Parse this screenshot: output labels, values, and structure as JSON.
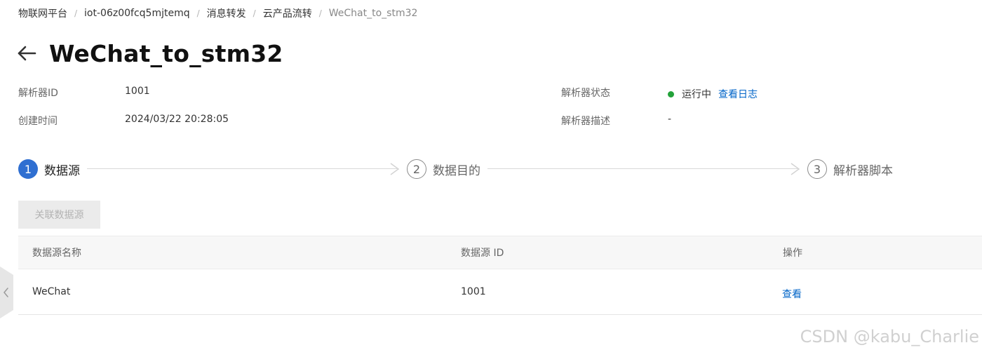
{
  "breadcrumb": {
    "items": [
      "物联网平台",
      "iot-06z00fcq5mjtemq",
      "消息转发",
      "云产品流转",
      "WeChat_to_stm32"
    ],
    "separator": "/"
  },
  "header": {
    "title": "WeChat_to_stm32",
    "back_icon": "arrow-left-icon"
  },
  "info": {
    "parser_id_label": "解析器ID",
    "parser_id_value": "1001",
    "created_label": "创建时间",
    "created_value": "2024/03/22 20:28:05",
    "status_label": "解析器状态",
    "status_value": "运行中",
    "status_color": "#23a23a",
    "view_log_link": "查看日志",
    "desc_label": "解析器描述",
    "desc_value": "-"
  },
  "steps": [
    {
      "number": "1",
      "label": "数据源",
      "state": "active"
    },
    {
      "number": "2",
      "label": "数据目的",
      "state": "idle"
    },
    {
      "number": "3",
      "label": "解析器脚本",
      "state": "idle"
    }
  ],
  "actions": {
    "associate_source_label": "关联数据源",
    "associate_source_disabled": true
  },
  "table": {
    "columns": [
      "数据源名称",
      "数据源 ID",
      "操作"
    ],
    "rows": [
      {
        "name": "WeChat",
        "id": "1001",
        "action": "查看"
      }
    ]
  },
  "side_tab": {
    "icon": "chevron-left-icon"
  },
  "watermark": "CSDN @kabu_Charlie",
  "colors": {
    "accent": "#2f6fd1",
    "link": "#0064c8",
    "running": "#23a23a"
  }
}
